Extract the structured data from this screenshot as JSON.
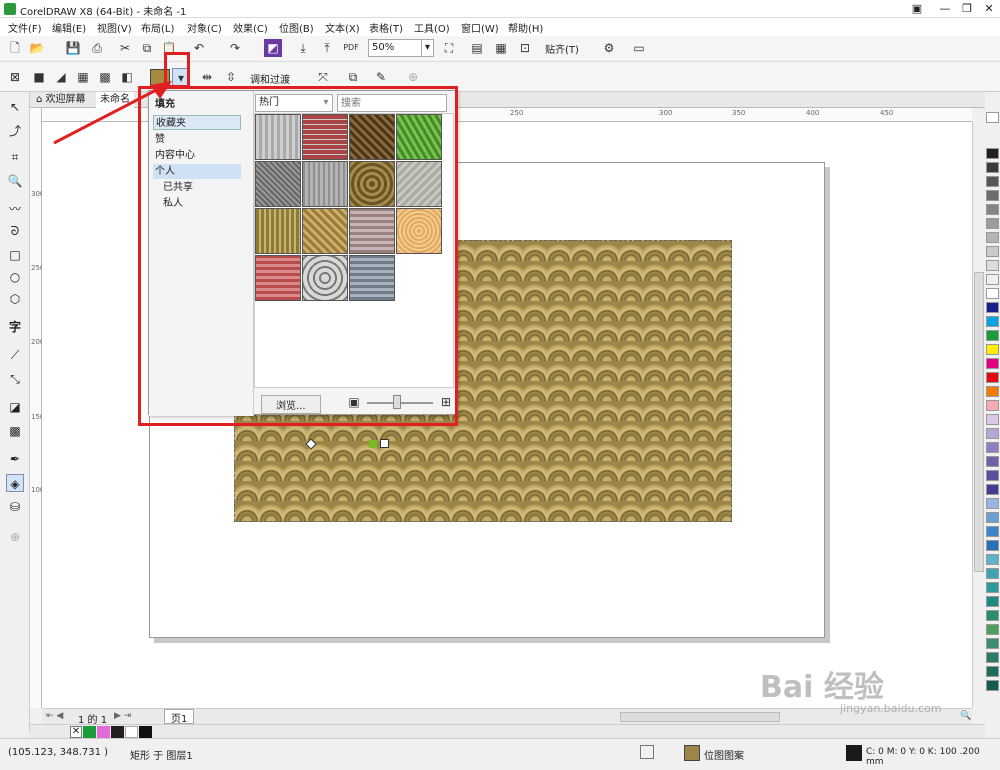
{
  "window": {
    "title": "CorelDRAW X8 (64-Bit) - 未命名 -1"
  },
  "menu": [
    "文件(F)",
    "编辑(E)",
    "视图(V)",
    "布局(L)",
    "对象(C)",
    "效果(C)",
    "位图(B)",
    "文本(X)",
    "表格(T)",
    "工具(O)",
    "窗口(W)",
    "帮助(H)"
  ],
  "toolbar1": {
    "zoom": "50%",
    "snap": "贴齐(T)"
  },
  "toolbar2": {
    "blend_label": "调和过渡"
  },
  "tabs": {
    "welcome": "欢迎屏幕",
    "doc": "未命名"
  },
  "rulers": {
    "h": [
      "250",
      "300",
      "350",
      "400",
      "450"
    ],
    "v": [
      "300",
      "250",
      "200",
      "150",
      "100"
    ]
  },
  "flyout": {
    "title": "填充",
    "filter": "热门",
    "search_placeholder": "搜索",
    "categories": [
      "收藏夹",
      "赞",
      "内容中心",
      "个人",
      "已共享",
      "私人"
    ],
    "browse": "浏览..."
  },
  "pagenav": {
    "counter": "1 的 1",
    "page_tab": "页1"
  },
  "status": {
    "coords": "(105.123, 348.731 )",
    "object": "矩形 于 图层1",
    "fill_label": "位图图案",
    "color": "C: 0 M: 0 Y: 0 K: 100  .200 mm"
  },
  "watermark": {
    "text": "Bai 经验",
    "sub": "jingyan.baidu.com"
  },
  "colors": {
    "accent": "#e02020",
    "fill_tan": "#9b8548"
  }
}
